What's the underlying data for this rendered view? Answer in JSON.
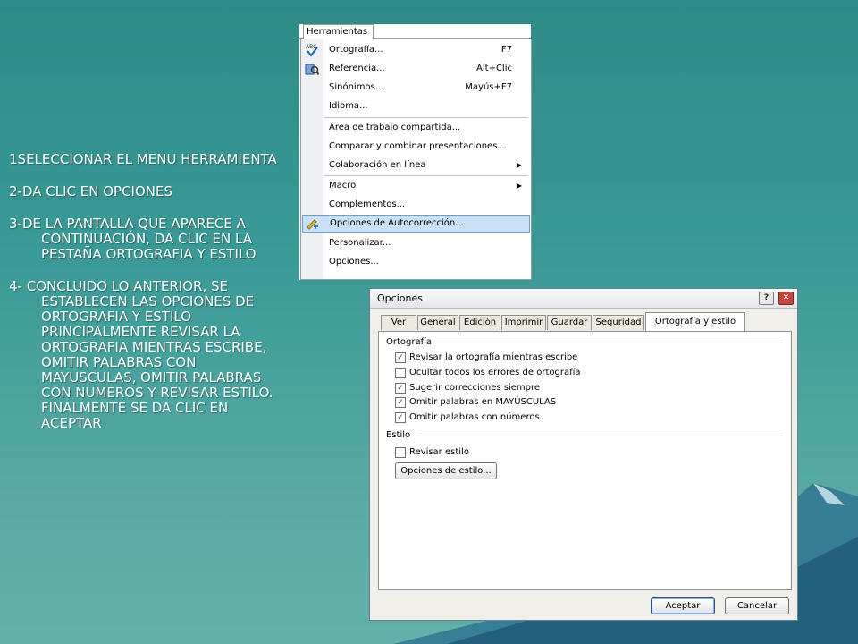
{
  "steps": [
    "1SELECCIONAR EL MENU HERRAMIENTA",
    "2-DA CLIC EN OPCIONES",
    "3-DE LA PANTALLA QUE APARECE A CONTINUACIÓN, DA  CLIC EN LA PESTAÑA ORTOGRAFIA Y ESTILO",
    "4- CONCLUIDO LO ANTERIOR, SE ESTABLECEN LAS OPCIONES DE ORTOGRAFIA Y ESTILO PRINCIPALMENTE REVISAR LA ORTOGRAFIA MIENTRAS ESCRIBE, OMITIR PALABRAS CON MAYUSCULAS, OMITIR PALABRAS CON NUMEROS Y REVISAR ESTILO. FINALMENTE SE DA CLIC EN ACEPTAR"
  ],
  "menu": {
    "title": "Herramientas",
    "items": [
      {
        "label": "Ortografía...",
        "shortcut": "F7",
        "icon": "spelling-abc-icon"
      },
      {
        "label": "Referencia...",
        "shortcut": "Alt+Clic",
        "icon": "research-icon"
      },
      {
        "label": "Sinónimos...",
        "shortcut": "Mayús+F7"
      },
      {
        "label": "Idioma..."
      },
      {
        "label": "Área de trabajo compartida..."
      },
      {
        "label": "Comparar y combinar presentaciones..."
      },
      {
        "label": "Colaboración en línea",
        "submenu": "▶"
      },
      {
        "label": "Macro",
        "submenu": "▶"
      },
      {
        "label": "Complementos..."
      },
      {
        "label": "Opciones de Autocorrección...",
        "icon": "autocorrect-icon",
        "highlighted": true
      },
      {
        "label": "Personalizar..."
      },
      {
        "label": "Opciones..."
      }
    ]
  },
  "dialog": {
    "title": "Opciones",
    "help": "?",
    "close": "✕",
    "tabs": [
      "Ver",
      "General",
      "Edición",
      "Imprimir",
      "Guardar",
      "Seguridad",
      "Ortografía y estilo"
    ],
    "active_tab": "Ortografía y estilo",
    "group_ortografia": "Ortografía",
    "checks": [
      {
        "label": "Revisar la ortografía mientras escribe",
        "checked": true
      },
      {
        "label": "Ocultar todos los errores de ortografía",
        "checked": false
      },
      {
        "label": "Sugerir correcciones siempre",
        "checked": true
      },
      {
        "label": "Omitir palabras en MAYÚSCULAS",
        "checked": true
      },
      {
        "label": "Omitir palabras con números",
        "checked": true
      }
    ],
    "group_estilo": "Estilo",
    "style_check": {
      "label": "Revisar estilo",
      "checked": false
    },
    "style_button": "Opciones de estilo...",
    "ok": "Aceptar",
    "cancel": "Cancelar"
  }
}
